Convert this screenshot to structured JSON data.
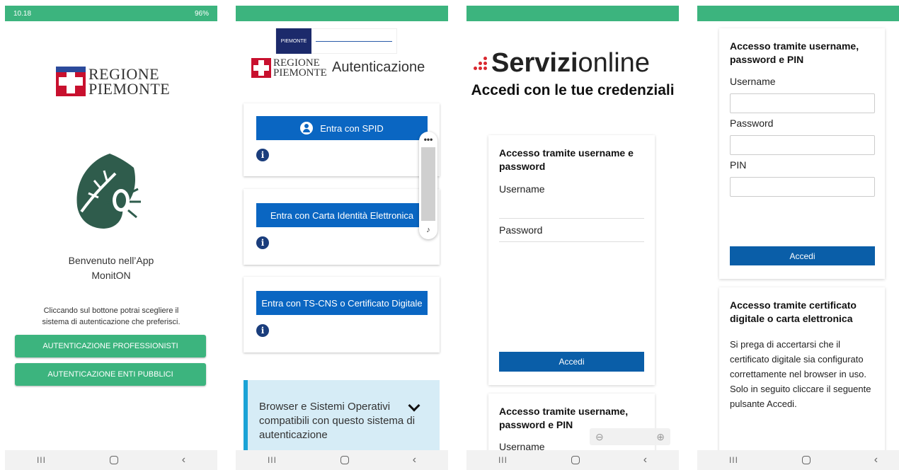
{
  "status": {
    "time": "10.18",
    "indicators": "96%"
  },
  "screen1": {
    "brand_line1": "REGIONE",
    "brand_line2": "PIEMONTE",
    "welcome_line1": "Benvenuto nell’App",
    "welcome_line2": "MonitON",
    "hint_line1": "Cliccando sul bottone potrai scegliere il",
    "hint_line2": "sistema di autenticazione che preferisci.",
    "btn_professionisti": "AUTENTICAZIONE PROFESSIONISTI",
    "btn_enti": "AUTENTICAZIONE ENTI PUBBLICI",
    "logo_icon": "leaf-bug-icon"
  },
  "screen2": {
    "banner_label": "PIEMONTE",
    "brand_line1": "REGIONE",
    "brand_line2": "PIEMONTE",
    "title": "Autenticazione",
    "spid_btn": "Entra con SPID",
    "cie_btn": "Entra con Carta Identità Elettronica",
    "cns_btn": "Entra con TS-CNS o Certificato Digitale",
    "info_glyph": "i",
    "menu_dots": "•••",
    "browser_text": "Browser e Sistemi Operativi compatibili con questo sistema di autenticazione"
  },
  "screen3": {
    "logo_bold": "Servizi",
    "logo_light": "online",
    "subtitle": "Accedi con le tue credenziali",
    "card1_title": "Accesso tramite username e password",
    "username_label": "Username",
    "password_label": "Password",
    "accedi": "Accedi",
    "card2_title": "Accesso tramite username, password e PIN",
    "card2_username": "Username"
  },
  "screen4": {
    "card1_title": "Accesso tramite username, password e PIN",
    "username_label": "Username",
    "password_label": "Password",
    "pin_label": "PIN",
    "accedi": "Accedi",
    "card2_title": "Accesso tramite certificato digitale o carta elettronica",
    "card2_text": "Si prega di accertarsi che il certificato digitale sia configurato correttamente nel browser in uso. Solo in seguito cliccare il seguente pulsante Accedi."
  },
  "nav": {
    "recent": "III",
    "back": "‹"
  },
  "colors": {
    "green": "#3cb47e",
    "blue": "#0a66c2",
    "dark_blue": "#0a5ea8",
    "red": "#d9282f"
  }
}
